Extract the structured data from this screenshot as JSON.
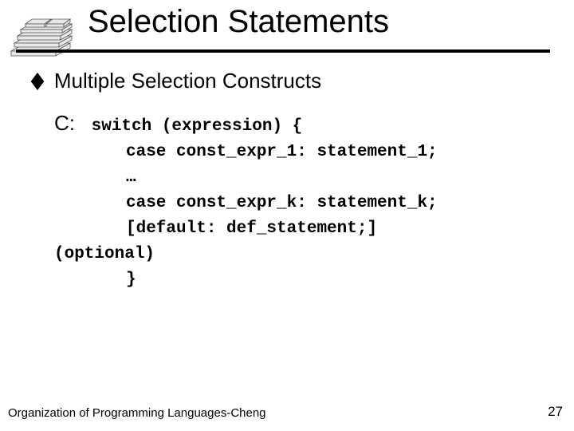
{
  "title": "Selection Statements",
  "bullet": {
    "marker": "◆",
    "text": "Multiple Selection Constructs"
  },
  "code": {
    "label": "C:",
    "l1": "switch (expression) {",
    "l2": "case   const_expr_1:  statement_1;",
    "l3": "…",
    "l4": "case   const_expr_k:  statement_k;",
    "l5": "[default: def_statement;]",
    "l6": "(optional)",
    "l7": "}"
  },
  "footer": {
    "left": "Organization of Programming Languages-Cheng",
    "right": "27"
  }
}
